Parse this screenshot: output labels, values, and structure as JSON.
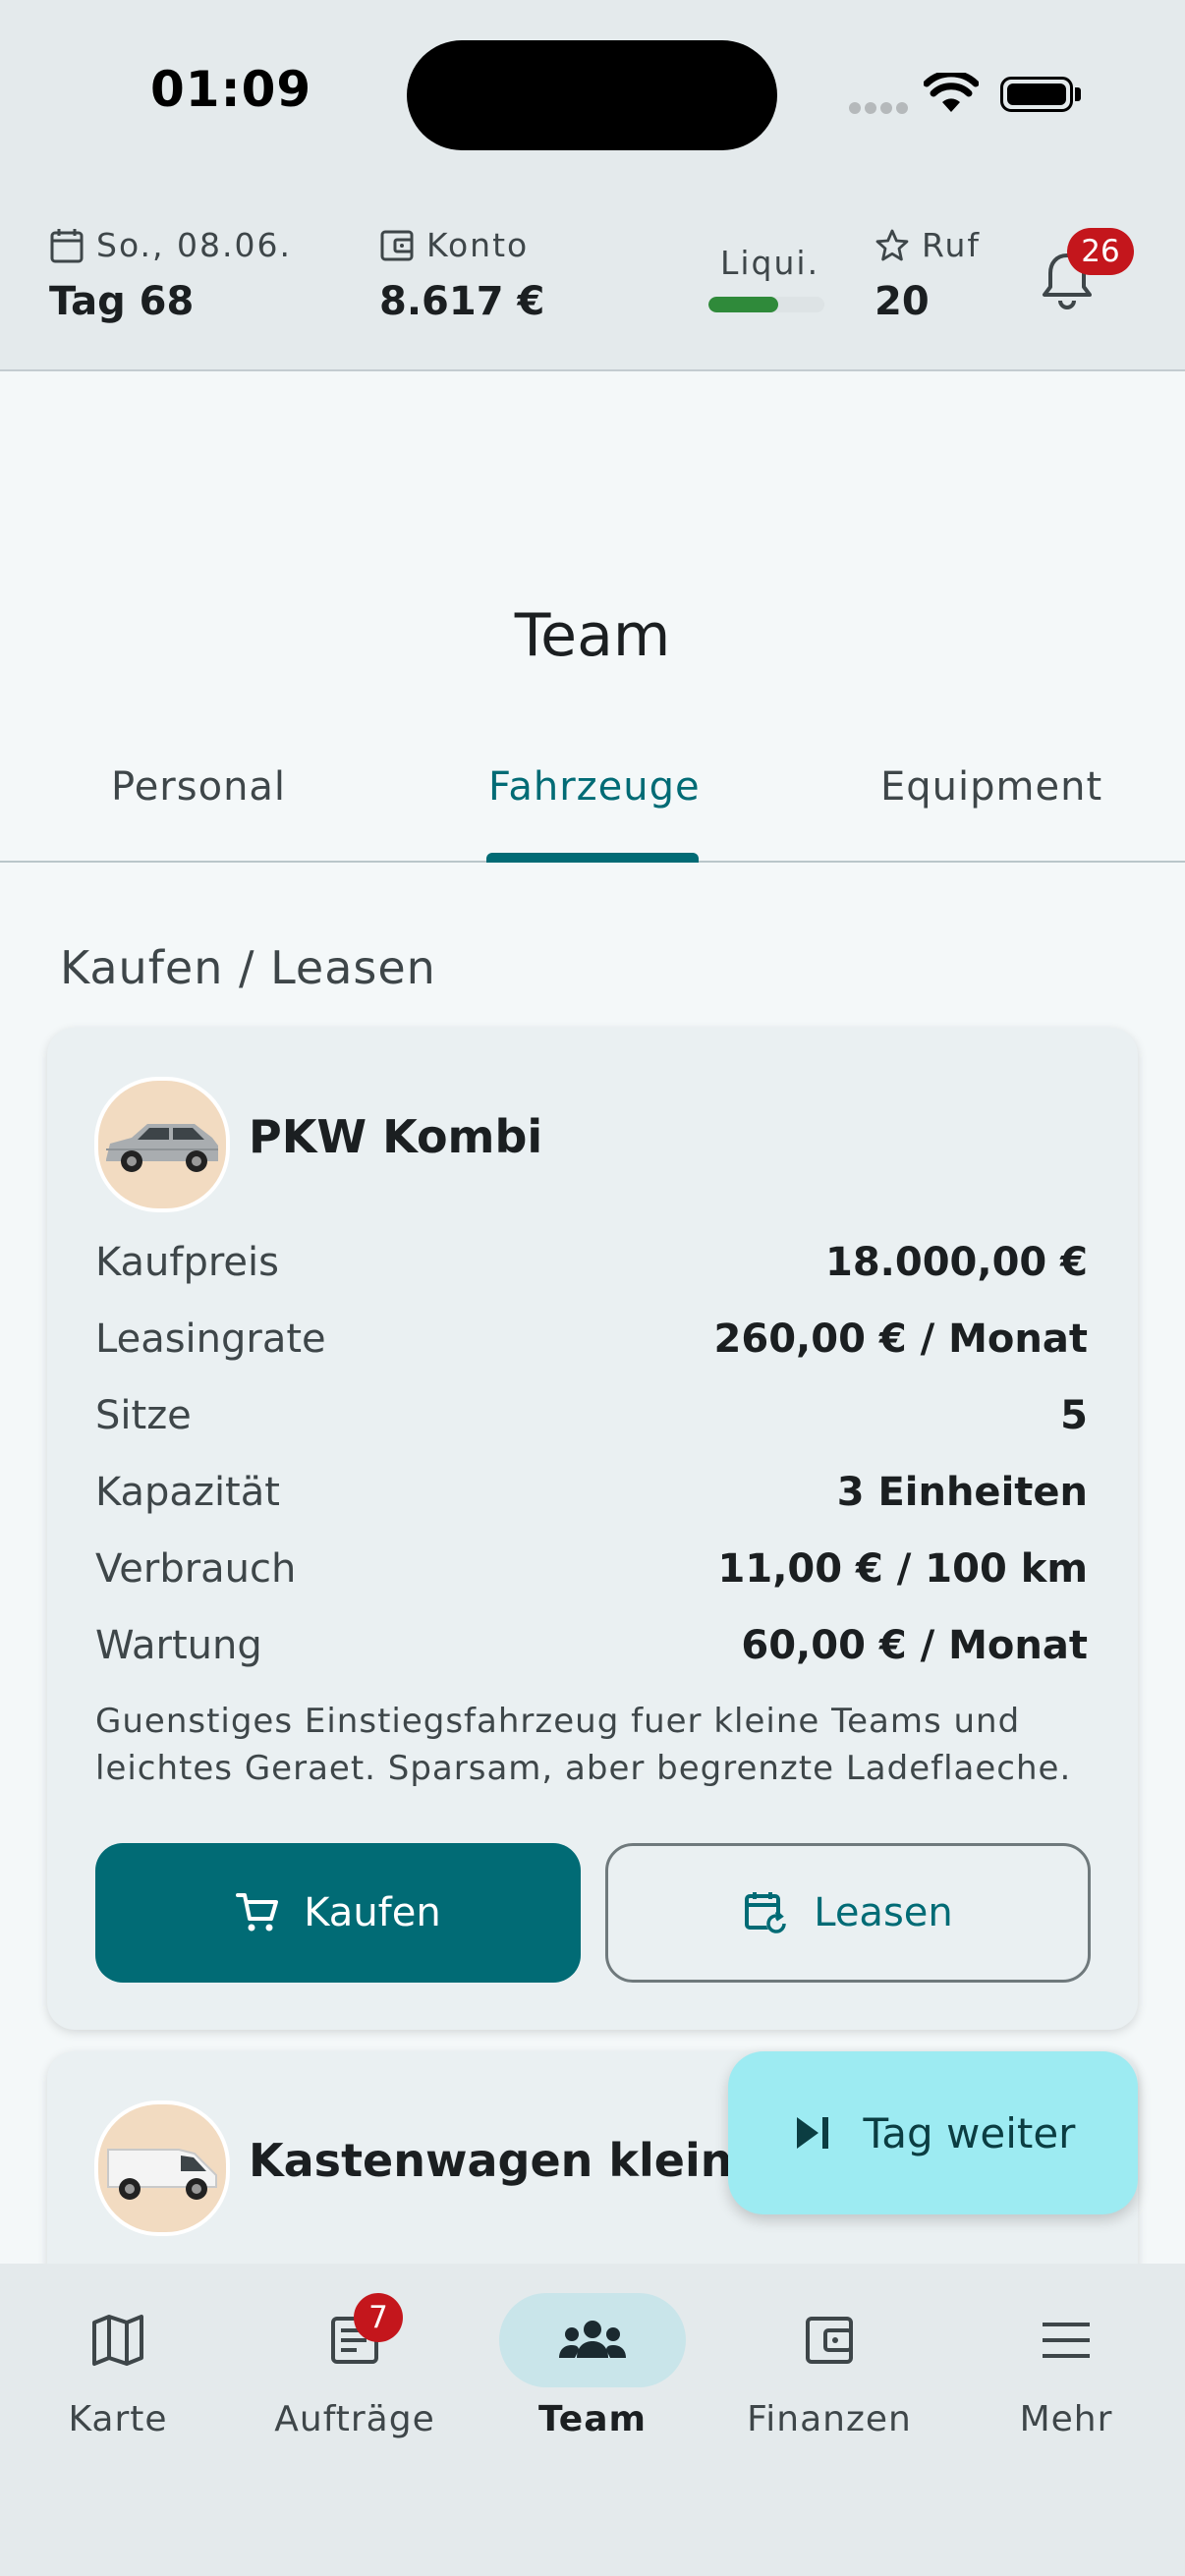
{
  "status_bar": {
    "time": "01:09"
  },
  "stats": {
    "date_label": "So., 08.06.",
    "day_value": "Tag 68",
    "account_label": "Konto",
    "account_value": "8.617 €",
    "liquidity_label": "Liqui.",
    "liquidity_fraction": 0.6,
    "reputation_label": "Ruf",
    "reputation_value": "20",
    "notifications_count": "26"
  },
  "page": {
    "title": "Team"
  },
  "tabs": [
    {
      "label": "Personal",
      "active": false
    },
    {
      "label": "Fahrzeuge",
      "active": true
    },
    {
      "label": "Equipment",
      "active": false
    }
  ],
  "section_title": "Kaufen / Leasen",
  "vehicles": [
    {
      "name": "PKW Kombi",
      "rows": [
        {
          "label": "Kaufpreis",
          "value": "18.000,00 €"
        },
        {
          "label": "Leasingrate",
          "value": "260,00 € / Monat"
        },
        {
          "label": "Sitze",
          "value": "5"
        },
        {
          "label": "Kapazität",
          "value": "3 Einheiten"
        },
        {
          "label": "Verbrauch",
          "value": "11,00 € / 100 km"
        },
        {
          "label": "Wartung",
          "value": "60,00 € / Monat"
        }
      ],
      "description": "Guenstiges Einstiegsfahrzeug fuer kleine Teams und leichtes Geraet. Sparsam, aber begrenzte Ladeflaeche.",
      "buy_label": "Kaufen",
      "lease_label": "Leasen"
    },
    {
      "name": "Kastenwagen klein"
    }
  ],
  "fab": {
    "label": "Tag weiter"
  },
  "bottom_nav": [
    {
      "label": "Karte",
      "icon": "map-icon"
    },
    {
      "label": "Aufträge",
      "icon": "orders-icon",
      "badge": "7"
    },
    {
      "label": "Team",
      "icon": "team-icon",
      "active": true
    },
    {
      "label": "Finanzen",
      "icon": "wallet-icon"
    },
    {
      "label": "Mehr",
      "icon": "menu-icon"
    }
  ],
  "colors": {
    "primary": "#016b75",
    "fab": "#9debf2",
    "badge": "#c4161c",
    "liquidity": "#2f8a3a"
  }
}
